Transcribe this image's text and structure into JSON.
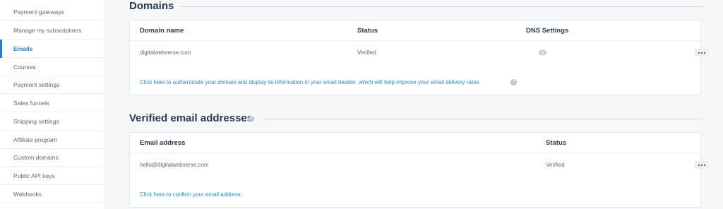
{
  "sidebar": {
    "items": [
      {
        "label": "Payment gateways",
        "active": false
      },
      {
        "label": "Manage my subscriptions",
        "active": false
      },
      {
        "label": "Emails",
        "active": true
      },
      {
        "label": "Courses",
        "active": false
      },
      {
        "label": "Payment settings",
        "active": false
      },
      {
        "label": "Sales funnels",
        "active": false
      },
      {
        "label": "Shipping settings",
        "active": false
      },
      {
        "label": "Affiliate program",
        "active": false
      },
      {
        "label": "Custom domains",
        "active": false
      },
      {
        "label": "Public API keys",
        "active": false
      },
      {
        "label": "Webhooks",
        "active": false
      }
    ]
  },
  "domains": {
    "title": "Domains",
    "columns": {
      "name": "Domain name",
      "status": "Status",
      "dns": "DNS Settings"
    },
    "rows": [
      {
        "domain": "digitalwebverse.com",
        "status": "Verified"
      }
    ],
    "auth_link": "Click here to authenticate your domain and display its information in your email header, which will help improve your email delivery rates"
  },
  "emails": {
    "title": "Verified email addresses",
    "columns": {
      "email": "Email address",
      "status": "Status"
    },
    "rows": [
      {
        "email": "hello@digitalwebverse.com",
        "status": "Verified"
      }
    ],
    "confirm_link": "Click here to confirm your email address"
  },
  "colors": {
    "accent": "#1f7fd3",
    "link": "#1f8fe0",
    "heading": "#283a54"
  }
}
